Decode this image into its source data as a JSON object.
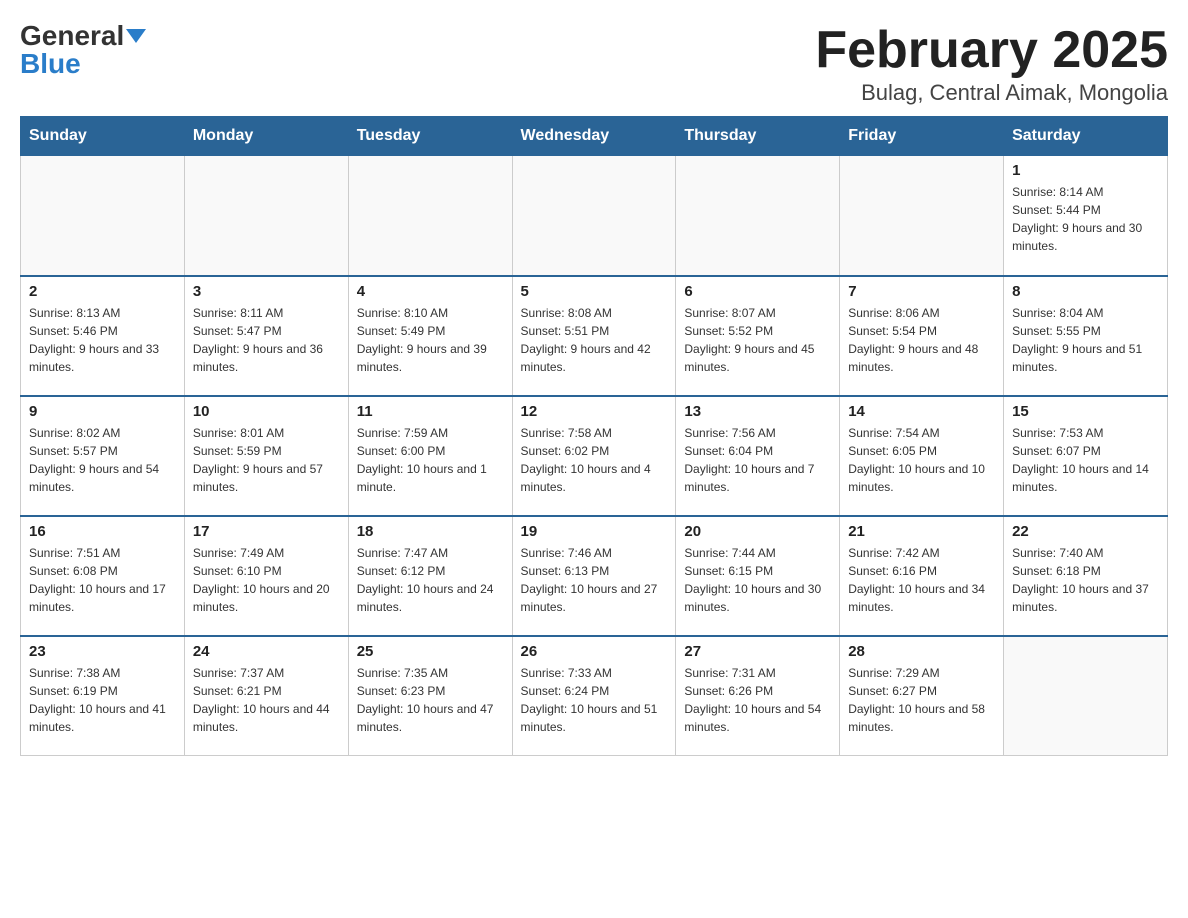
{
  "header": {
    "logo_general": "General",
    "logo_blue": "Blue",
    "title": "February 2025",
    "subtitle": "Bulag, Central Aimak, Mongolia"
  },
  "weekdays": [
    "Sunday",
    "Monday",
    "Tuesday",
    "Wednesday",
    "Thursday",
    "Friday",
    "Saturday"
  ],
  "weeks": [
    [
      {
        "day": "",
        "info": ""
      },
      {
        "day": "",
        "info": ""
      },
      {
        "day": "",
        "info": ""
      },
      {
        "day": "",
        "info": ""
      },
      {
        "day": "",
        "info": ""
      },
      {
        "day": "",
        "info": ""
      },
      {
        "day": "1",
        "info": "Sunrise: 8:14 AM\nSunset: 5:44 PM\nDaylight: 9 hours and 30 minutes."
      }
    ],
    [
      {
        "day": "2",
        "info": "Sunrise: 8:13 AM\nSunset: 5:46 PM\nDaylight: 9 hours and 33 minutes."
      },
      {
        "day": "3",
        "info": "Sunrise: 8:11 AM\nSunset: 5:47 PM\nDaylight: 9 hours and 36 minutes."
      },
      {
        "day": "4",
        "info": "Sunrise: 8:10 AM\nSunset: 5:49 PM\nDaylight: 9 hours and 39 minutes."
      },
      {
        "day": "5",
        "info": "Sunrise: 8:08 AM\nSunset: 5:51 PM\nDaylight: 9 hours and 42 minutes."
      },
      {
        "day": "6",
        "info": "Sunrise: 8:07 AM\nSunset: 5:52 PM\nDaylight: 9 hours and 45 minutes."
      },
      {
        "day": "7",
        "info": "Sunrise: 8:06 AM\nSunset: 5:54 PM\nDaylight: 9 hours and 48 minutes."
      },
      {
        "day": "8",
        "info": "Sunrise: 8:04 AM\nSunset: 5:55 PM\nDaylight: 9 hours and 51 minutes."
      }
    ],
    [
      {
        "day": "9",
        "info": "Sunrise: 8:02 AM\nSunset: 5:57 PM\nDaylight: 9 hours and 54 minutes."
      },
      {
        "day": "10",
        "info": "Sunrise: 8:01 AM\nSunset: 5:59 PM\nDaylight: 9 hours and 57 minutes."
      },
      {
        "day": "11",
        "info": "Sunrise: 7:59 AM\nSunset: 6:00 PM\nDaylight: 10 hours and 1 minute."
      },
      {
        "day": "12",
        "info": "Sunrise: 7:58 AM\nSunset: 6:02 PM\nDaylight: 10 hours and 4 minutes."
      },
      {
        "day": "13",
        "info": "Sunrise: 7:56 AM\nSunset: 6:04 PM\nDaylight: 10 hours and 7 minutes."
      },
      {
        "day": "14",
        "info": "Sunrise: 7:54 AM\nSunset: 6:05 PM\nDaylight: 10 hours and 10 minutes."
      },
      {
        "day": "15",
        "info": "Sunrise: 7:53 AM\nSunset: 6:07 PM\nDaylight: 10 hours and 14 minutes."
      }
    ],
    [
      {
        "day": "16",
        "info": "Sunrise: 7:51 AM\nSunset: 6:08 PM\nDaylight: 10 hours and 17 minutes."
      },
      {
        "day": "17",
        "info": "Sunrise: 7:49 AM\nSunset: 6:10 PM\nDaylight: 10 hours and 20 minutes."
      },
      {
        "day": "18",
        "info": "Sunrise: 7:47 AM\nSunset: 6:12 PM\nDaylight: 10 hours and 24 minutes."
      },
      {
        "day": "19",
        "info": "Sunrise: 7:46 AM\nSunset: 6:13 PM\nDaylight: 10 hours and 27 minutes."
      },
      {
        "day": "20",
        "info": "Sunrise: 7:44 AM\nSunset: 6:15 PM\nDaylight: 10 hours and 30 minutes."
      },
      {
        "day": "21",
        "info": "Sunrise: 7:42 AM\nSunset: 6:16 PM\nDaylight: 10 hours and 34 minutes."
      },
      {
        "day": "22",
        "info": "Sunrise: 7:40 AM\nSunset: 6:18 PM\nDaylight: 10 hours and 37 minutes."
      }
    ],
    [
      {
        "day": "23",
        "info": "Sunrise: 7:38 AM\nSunset: 6:19 PM\nDaylight: 10 hours and 41 minutes."
      },
      {
        "day": "24",
        "info": "Sunrise: 7:37 AM\nSunset: 6:21 PM\nDaylight: 10 hours and 44 minutes."
      },
      {
        "day": "25",
        "info": "Sunrise: 7:35 AM\nSunset: 6:23 PM\nDaylight: 10 hours and 47 minutes."
      },
      {
        "day": "26",
        "info": "Sunrise: 7:33 AM\nSunset: 6:24 PM\nDaylight: 10 hours and 51 minutes."
      },
      {
        "day": "27",
        "info": "Sunrise: 7:31 AM\nSunset: 6:26 PM\nDaylight: 10 hours and 54 minutes."
      },
      {
        "day": "28",
        "info": "Sunrise: 7:29 AM\nSunset: 6:27 PM\nDaylight: 10 hours and 58 minutes."
      },
      {
        "day": "",
        "info": ""
      }
    ]
  ]
}
